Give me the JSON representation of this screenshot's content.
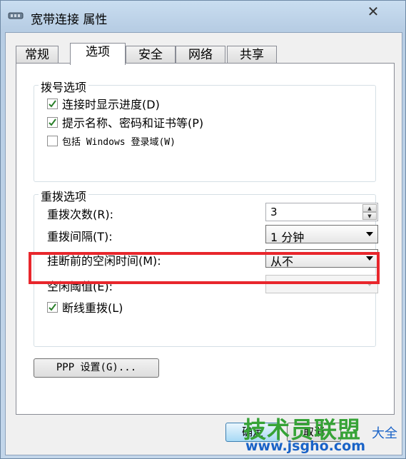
{
  "window": {
    "title": "宽带连接 属性",
    "close_glyph": "✕"
  },
  "tabs": [
    {
      "label": "常规",
      "active": false
    },
    {
      "label": "选项",
      "active": true
    },
    {
      "label": "安全",
      "active": false
    },
    {
      "label": "网络",
      "active": false
    },
    {
      "label": "共享",
      "active": false
    }
  ],
  "dial_group": {
    "title": "拨号选项",
    "options": [
      {
        "label": "连接时显示进度(D)",
        "checked": true
      },
      {
        "label": "提示名称、密码和证书等(P)",
        "checked": true
      },
      {
        "label": "包括 Windows 登录域(W)",
        "checked": false
      }
    ]
  },
  "redial_group": {
    "title": "重拨选项",
    "redial_attempts_label": "重拨次数(R):",
    "redial_attempts_value": "3",
    "redial_interval_label": "重拨间隔(T):",
    "redial_interval_value": "1 分钟",
    "idle_time_label": "挂断前的空闲时间(M):",
    "idle_time_value": "从不",
    "idle_threshold_label": "空闲阈值(E):",
    "idle_threshold_value": "",
    "redial_on_drop_label": "断线重拨(L)",
    "redial_on_drop_checked": true
  },
  "ppp_button": "PPP 设置(G)...",
  "footer": {
    "ok_partial": "确定",
    "cancel_partial": "取消"
  },
  "watermark": {
    "brand": "技术员联盟",
    "url": "www.jsgho.com",
    "suffix": "大全"
  },
  "colors": {
    "highlight": "#e8262c",
    "watermark_green": "#36a336",
    "watermark_blue": "#1a63c7"
  }
}
